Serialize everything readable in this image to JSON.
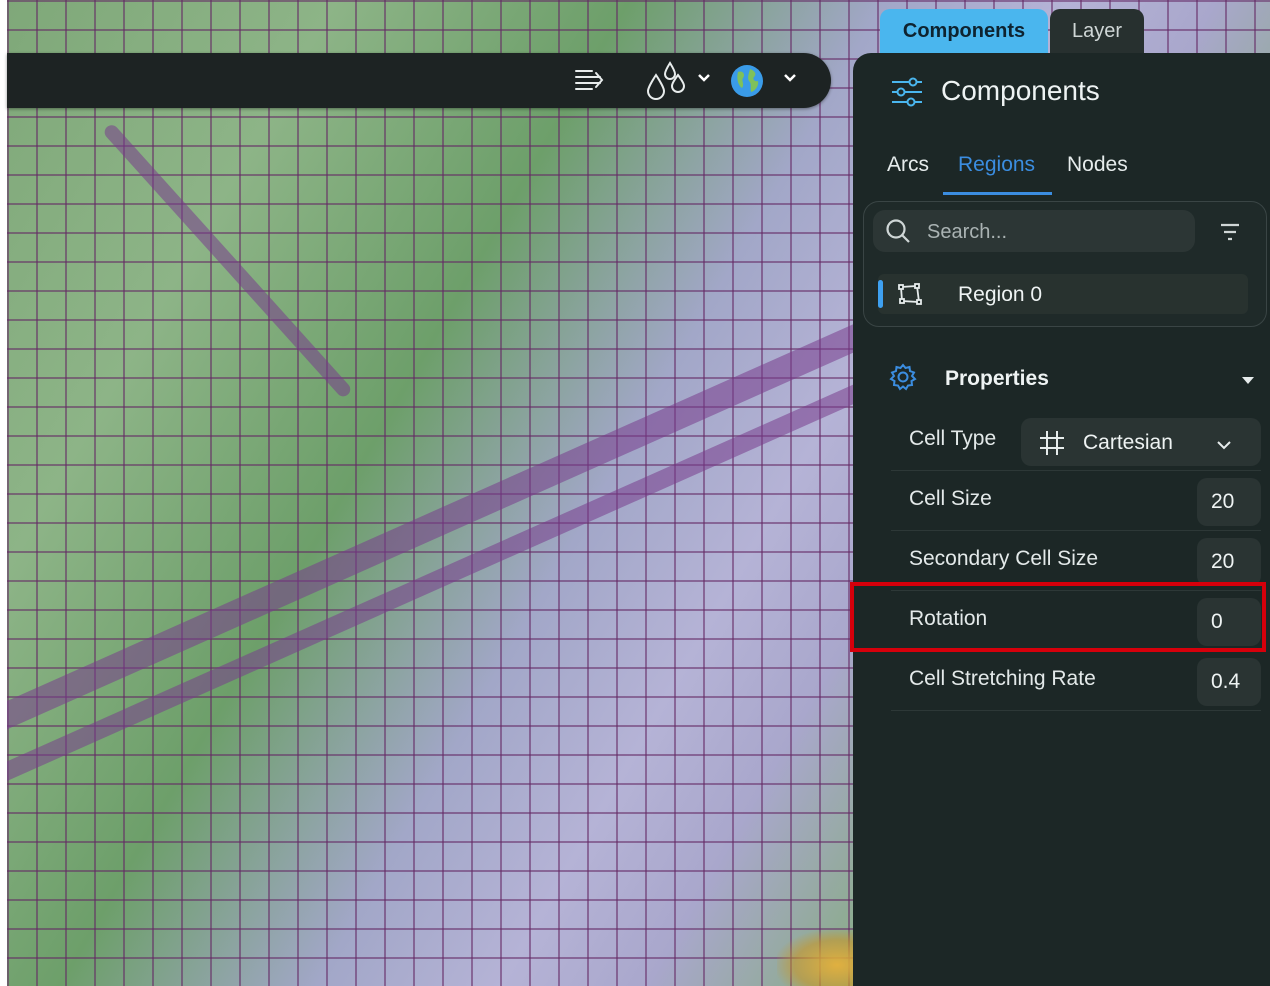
{
  "tabs": {
    "components": "Components",
    "layer": "Layer"
  },
  "panel": {
    "title": "Components",
    "subtabs": [
      {
        "label": "Arcs"
      },
      {
        "label": "Regions"
      },
      {
        "label": "Nodes"
      }
    ],
    "selected_subtab": "Regions",
    "search": {
      "placeholder": "Search..."
    },
    "items": [
      {
        "label": "Region 0"
      }
    ]
  },
  "properties": {
    "title": "Properties",
    "cell_type": {
      "label": "Cell Type",
      "value": "Cartesian"
    },
    "rows": [
      {
        "label": "Cell Size",
        "value": "20"
      },
      {
        "label": "Secondary Cell Size",
        "value": "20"
      },
      {
        "label": "Rotation",
        "value": "0"
      },
      {
        "label": "Cell Stretching Rate",
        "value": "0.4"
      }
    ],
    "highlighted_row": "Rotation"
  },
  "toolbar": {
    "icons": [
      "wind-icon",
      "water-drops-icon",
      "globe-icon"
    ]
  },
  "colors": {
    "accent": "#3b8de0",
    "tab_active": "#4ab6ee",
    "panel_bg": "#1c2726",
    "highlight": "#d6000b",
    "grid_line": "#642864"
  }
}
